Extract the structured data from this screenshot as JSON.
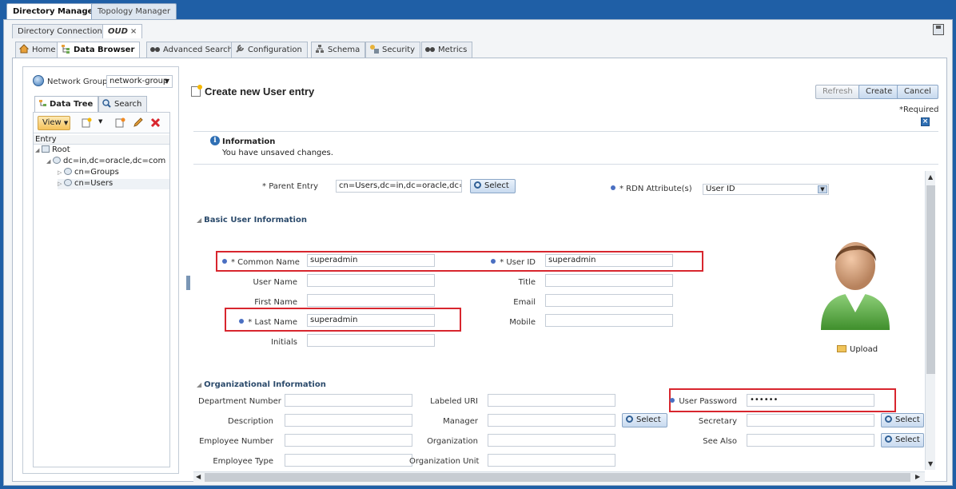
{
  "app_tabs": [
    "Directory Manager",
    "Topology Manager"
  ],
  "conn_tabs": {
    "connections": "Directory Connections",
    "oud": "OUD",
    "close": "×"
  },
  "section_tabs": [
    "Home",
    "Data Browser",
    "Advanced Search",
    "Configuration",
    "Schema",
    "Security",
    "Metrics"
  ],
  "left": {
    "network_group_label": "Network Group",
    "network_group_value": "network-group",
    "tabs": [
      "Data Tree",
      "Search"
    ],
    "view_label": "View",
    "entry_header": "Entry",
    "tree": [
      "Root",
      "dc=in,dc=oracle,dc=com",
      "cn=Groups",
      "cn=Users"
    ]
  },
  "page": {
    "title": "Create new User entry",
    "buttons": {
      "refresh": "Refresh",
      "create": "Create",
      "cancel": "Cancel"
    },
    "required": "*Required",
    "info_title": "Information",
    "info_message": "You have unsaved changes."
  },
  "form": {
    "parent_entry_label": "* Parent Entry",
    "parent_entry_value": "cn=Users,dc=in,dc=oracle,dc=com",
    "select_label": "Select",
    "rdn_label": "* RDN Attribute(s)",
    "rdn_value": "User ID",
    "basic_section": "Basic User Information",
    "common_name_label": "* Common Name",
    "common_name_value": "superadmin",
    "user_id_label": "* User ID",
    "user_id_value": "superadmin",
    "user_name_label": "User Name",
    "title_label": "Title",
    "first_name_label": "First Name",
    "email_label": "Email",
    "last_name_label": "* Last Name",
    "last_name_value": "superadmin",
    "mobile_label": "Mobile",
    "initials_label": "Initials",
    "upload_label": "Upload",
    "org_section": "Organizational Information",
    "department_number_label": "Department Number",
    "labeled_uri_label": "Labeled URI",
    "user_password_label": "User Password",
    "user_password_value": "••••••",
    "description_label": "Description",
    "manager_label": "Manager",
    "secretary_label": "Secretary",
    "employee_number_label": "Employee Number",
    "organization_label": "Organization",
    "see_also_label": "See Also",
    "employee_type_label": "Employee Type",
    "organization_unit_label": "Organization Unit"
  }
}
